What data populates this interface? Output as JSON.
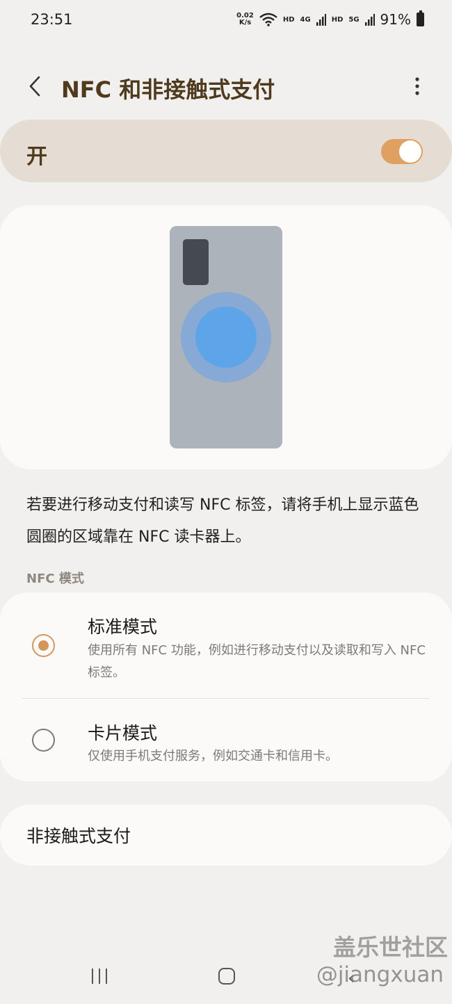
{
  "status_bar": {
    "time": "23:51",
    "net_speed_value": "0.02",
    "net_speed_unit": "K/s",
    "hd_1": "HD",
    "net_4g": "4G",
    "hd_2": "HD",
    "net_5g": "5G",
    "battery": "91%",
    "icons": [
      "wifi-icon",
      "signal-icon",
      "signal-icon",
      "battery-icon"
    ]
  },
  "header": {
    "title": "NFC 和非接触式支付",
    "back_icon": "chevron-left-icon",
    "more_icon": "more-vert-icon"
  },
  "master_switch": {
    "label": "开",
    "enabled": true,
    "accent_color": "#dfa061"
  },
  "illustration": {
    "description": "phone-back-nfc-illustration"
  },
  "description": "若要进行移动支付和读写 NFC 标签，请将手机上显示蓝色圆圈的区域靠在 NFC 读卡器上。",
  "nfc_mode": {
    "section_title": "NFC 模式",
    "options": [
      {
        "title": "标准模式",
        "desc": "使用所有 NFC 功能，例如进行移动支付以及读取和写入 NFC 标签。",
        "selected": true
      },
      {
        "title": "卡片模式",
        "desc": "仅使用手机支付服务，例如交通卡和信用卡。",
        "selected": false
      }
    ]
  },
  "contactless": {
    "label": "非接触式支付"
  },
  "nav_bar": {
    "icons": [
      "recent-apps-icon",
      "home-icon",
      "back-icon"
    ]
  },
  "watermark": {
    "brand": "盖乐世社区",
    "handle": "@jiangxuan"
  }
}
